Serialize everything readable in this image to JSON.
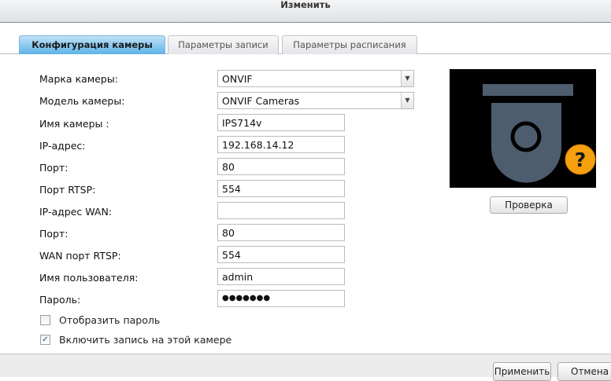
{
  "dialog": {
    "title": "Изменить"
  },
  "tabs": [
    {
      "label": "Конфигурация камеры",
      "active": true
    },
    {
      "label": "Параметры записи",
      "active": false
    },
    {
      "label": "Параметры расписания",
      "active": false
    }
  ],
  "form": {
    "brand": {
      "label": "Марка камеры:",
      "value": "ONVIF"
    },
    "model": {
      "label": "Модель камеры:",
      "value": "ONVIF Cameras"
    },
    "name": {
      "label": "Имя камеры :",
      "value": "IPS714v"
    },
    "ip": {
      "label": "IP-адрес:",
      "value": "192.168.14.12"
    },
    "port": {
      "label": "Порт:",
      "value": "80"
    },
    "rtsp": {
      "label": "Порт RTSP:",
      "value": "554"
    },
    "wan_ip": {
      "label": "IP-адрес WAN:",
      "value": ""
    },
    "wan_port": {
      "label": "Порт:",
      "value": "80"
    },
    "wan_rtsp": {
      "label": "WAN порт RTSP:",
      "value": "554"
    },
    "user": {
      "label": "Имя пользователя:",
      "value": "admin"
    },
    "password": {
      "label": "Пароль:",
      "value": "●●●●●●●"
    },
    "show_password": {
      "label": "Отобразить пароль",
      "checked": false
    },
    "enable_recording": {
      "label": "Включить запись на этой камере",
      "checked": true
    }
  },
  "preview": {
    "test_button": "Проверка",
    "badge": "?",
    "accent": "#f5a00f"
  },
  "footer": {
    "apply": "Применить",
    "cancel": "Отмена"
  }
}
